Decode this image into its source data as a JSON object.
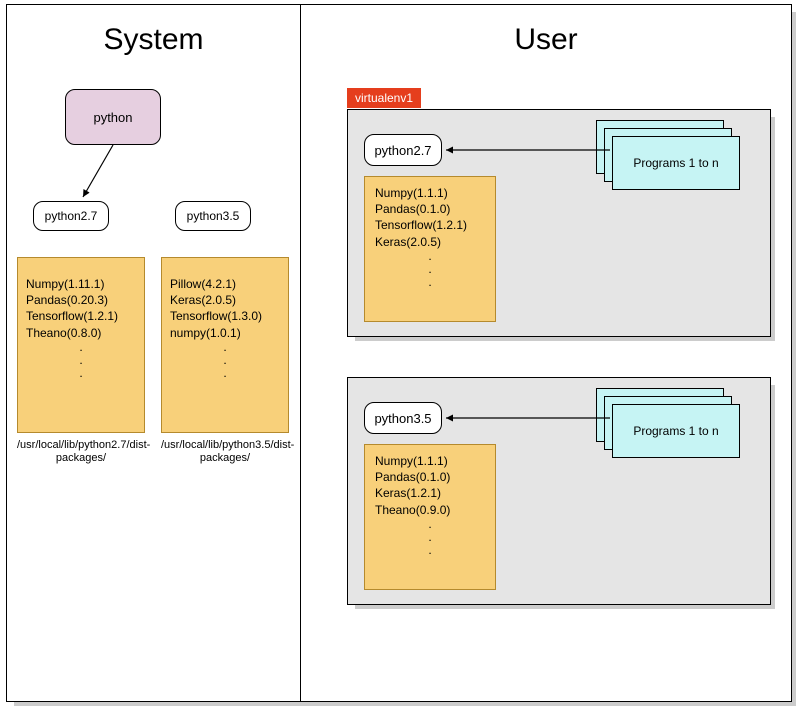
{
  "system": {
    "title": "System",
    "root": "python",
    "py27": "python2.7",
    "py35": "python3.5",
    "pkg27": {
      "l1": "Numpy(1.11.1)",
      "l2": "Pandas(0.20.3)",
      "l3": "Tensorflow(1.2.1)",
      "l4": "Theano(0.8.0)",
      "dots": ".\n.\n."
    },
    "pkg35": {
      "l1": "Pillow(4.2.1)",
      "l2": "Keras(2.0.5)",
      "l3": "Tensorflow(1.3.0)",
      "l4": "numpy(1.0.1)",
      "dots": ".\n.\n."
    },
    "cap27": "/usr/local/lib/python2.7/dist-packages/",
    "cap35": "/usr/local/lib/python3.5/dist-packages/"
  },
  "user": {
    "title": "User",
    "venv1": {
      "tag": "virtualenv1",
      "py": "python2.7",
      "pkg": {
        "l1": "Numpy(1.1.1)",
        "l2": "Pandas(0.1.0)",
        "l3": "Tensorflow(1.2.1)",
        "l4": "Keras(2.0.5)",
        "dots": ".\n.\n."
      },
      "programs": "Programs 1 to n"
    },
    "venv2": {
      "py": "python3.5",
      "pkg": {
        "l1": "Numpy(1.1.1)",
        "l2": "Pandas(0.1.0)",
        "l3": "Keras(1.2.1)",
        "l4": "Theano(0.9.0)",
        "dots": ".\n.\n."
      },
      "programs": "Programs 1 to n"
    }
  }
}
